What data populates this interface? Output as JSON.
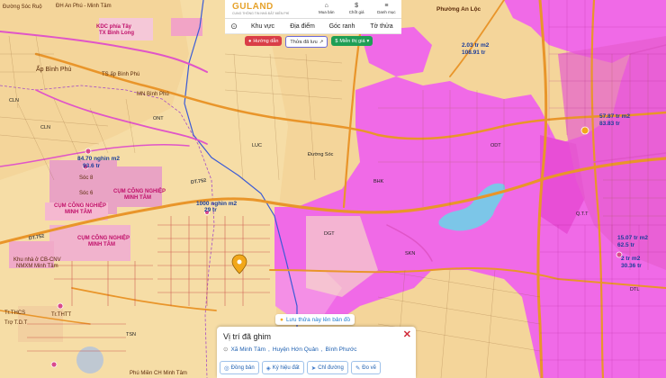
{
  "brand": {
    "name": "GULAND",
    "tagline": "CUNG THÔNG TIN NHÀ ĐẤT MIỄN PHÍ"
  },
  "top_actions": [
    {
      "label": "Mua bán",
      "icon": "house-icon"
    },
    {
      "label": "Chốt giá",
      "icon": "dollar-icon"
    },
    {
      "label": "Danh mục",
      "icon": "menu-icon"
    }
  ],
  "tabs": [
    "Khu vực",
    "Địa điểm",
    "Góc ranh",
    "Tờ thửa"
  ],
  "chips": {
    "directions": "Hướng dẫn",
    "plots": "Thửa đã lưu",
    "price": "Miễn thị giá"
  },
  "save_banner": "Lưu thửa này lên bản đồ",
  "card": {
    "title": "Vị trí đã ghim",
    "address_parts": [
      "Xã Minh Tâm",
      "Huyện Hớn Quản",
      "Bình Phước"
    ],
    "actions": [
      "Đồng bản",
      "Ký hiệu đất",
      "Chỉ đường",
      "Đo vẽ"
    ]
  },
  "map_labels": {
    "tl1": "Đường Sóc Ruộ",
    "tl2": "ĐH An Phú - Minh Tâm",
    "kdc": "KDC phía Tây",
    "kdc2": "TX Bình Long",
    "apbinhphu": "Ấp Bình Phú",
    "ts": "TS ấp Bình Phú",
    "mn1": "MN Bình Phú",
    "d752": "DT.752",
    "socs": "Sóc 8",
    "sochinh": "Sóc 6",
    "khucn": "CỤM CÔNG NGHIỆP",
    "khucn2": "MINH TÂM",
    "khucn3": "CỤM CÔNG NGHIỆP",
    "khucn4": "MINH TÂM",
    "khucn5": "CỤM CÔNG NGHIỆP",
    "khucn6": "MINH TÂM",
    "khunha": "Khu nhà ở CB-CNV",
    "khunha2": "NMXM Minh Tâm",
    "t1": "84.70 nghìn m2",
    "t1b": "93.6 tr",
    "t2": "1000 nghìn m2",
    "t2b": "29 tr",
    "t3": "2.03 tr m2",
    "t3b": "108.91 tr",
    "t4": "57.87 tr m2",
    "t4b": "83.83 tr",
    "t5": "15.07 tr m2",
    "t5b": "62.5 tr",
    "t6": "2 tr m2",
    "t6b": "30.36 tr",
    "pan": "Phường An Lộc",
    "qn": "Q.T.T",
    "ds": "Đường Sóc",
    "thcs": "Tr.THCS",
    "tht": "Tr.THTT",
    "tro": "Trợ T.D.T",
    "dq": "DT.752",
    "k1": "CLN",
    "k2": "ONT",
    "k3": "LUC",
    "k4": "BHK",
    "k5": "ODT",
    "k6": "SKN",
    "k7": "DGT",
    "k8": "DTL",
    "k9": "TSN",
    "k10": "CLN",
    "bottom": "Phú Miền CH Minh Tâm"
  }
}
